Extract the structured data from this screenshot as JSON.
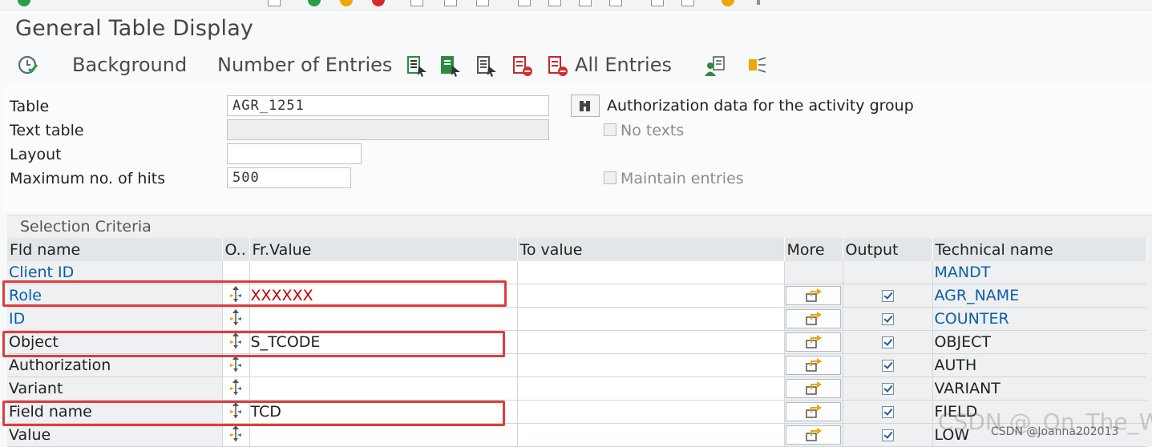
{
  "window": {
    "title": "General Table Display"
  },
  "toolbar": {
    "execute_icon": "execute-clock-icon",
    "background_label": "Background",
    "number_of_entries_label": "Number of Entries",
    "all_entries_label": "All Entries"
  },
  "form": {
    "table_label": "Table",
    "table_value": "AGR_1251",
    "table_description": "Authorization data for the activity group",
    "text_table_label": "Text table",
    "text_table_value": "",
    "layout_label": "Layout",
    "layout_value": "",
    "max_hits_label": "Maximum no. of hits",
    "max_hits_value": "500",
    "no_texts_label": "No texts",
    "maintain_entries_label": "Maintain entries"
  },
  "selection": {
    "title": "Selection Criteria",
    "headers": {
      "fld_name": "Fld name",
      "op": "O..",
      "fr_value": "Fr.Value",
      "to_value": "To value",
      "more": "More",
      "output": "Output",
      "tech_name": "Technical name"
    },
    "rows": [
      {
        "fld": "Client ID",
        "fr": "",
        "to": "",
        "output": false,
        "tech": "MANDT"
      },
      {
        "fld": "Role",
        "fr": "XXXXXX",
        "to": "",
        "output": true,
        "tech": "AGR_NAME"
      },
      {
        "fld": "ID",
        "fr": "",
        "to": "",
        "output": true,
        "tech": "COUNTER"
      },
      {
        "fld": "Object",
        "fr": "S_TCODE",
        "to": "",
        "output": true,
        "tech": "OBJECT"
      },
      {
        "fld": "Authorization",
        "fr": "",
        "to": "",
        "output": true,
        "tech": "AUTH"
      },
      {
        "fld": "Variant",
        "fr": "",
        "to": "",
        "output": true,
        "tech": "VARIANT"
      },
      {
        "fld": "Field name",
        "fr": "TCD",
        "to": "",
        "output": true,
        "tech": "FIELD"
      },
      {
        "fld": "Value",
        "fr": "",
        "to": "",
        "output": true,
        "tech": "LOW"
      }
    ]
  },
  "watermark": {
    "large": "CSDN @_On_The_Way",
    "small": "CSDN @Joanna202013"
  },
  "colors": {
    "link_blue": "#0b5fa5",
    "highlight_red": "#e03c3c",
    "role_value_red": "#c00000"
  }
}
